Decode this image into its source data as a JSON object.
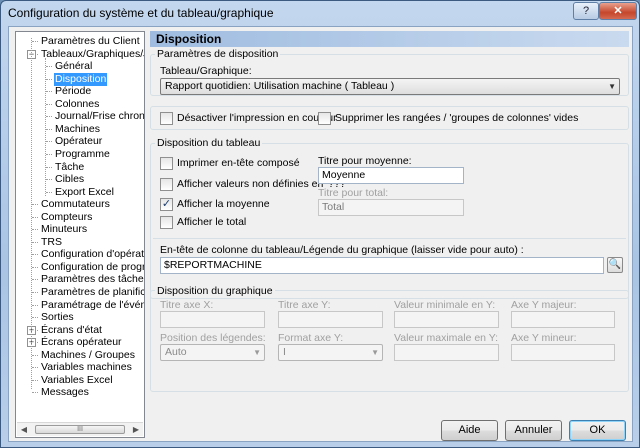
{
  "window": {
    "title": "Configuration du système et du tableau/graphique",
    "help_glyph": "?",
    "close_glyph": "✕"
  },
  "tree": {
    "items": [
      {
        "label": "Paramètres du Client"
      },
      {
        "label": "Tableaux/Graphiques/Journal",
        "expanded": true
      },
      {
        "label": "Général"
      },
      {
        "label": "Disposition",
        "selected": true
      },
      {
        "label": "Période"
      },
      {
        "label": "Colonnes"
      },
      {
        "label": "Journal/Frise chronologique"
      },
      {
        "label": "Machines"
      },
      {
        "label": "Opérateur"
      },
      {
        "label": "Programme"
      },
      {
        "label": "Tâche"
      },
      {
        "label": "Cibles"
      },
      {
        "label": "Export Excel"
      },
      {
        "label": "Commutateurs"
      },
      {
        "label": "Compteurs"
      },
      {
        "label": "Minuteurs"
      },
      {
        "label": "TRS"
      },
      {
        "label": "Configuration d'opérateur"
      },
      {
        "label": "Configuration de programme"
      },
      {
        "label": "Paramètres des tâches"
      },
      {
        "label": "Paramètres de planification"
      },
      {
        "label": "Paramétrage de l'événement"
      },
      {
        "label": "Sorties"
      },
      {
        "label": "Écrans d'état",
        "expandable": true
      },
      {
        "label": "Écrans opérateur",
        "expandable": true
      },
      {
        "label": "Machines / Groupes"
      },
      {
        "label": "Variables machines"
      },
      {
        "label": "Variables Excel"
      },
      {
        "label": "Messages"
      }
    ],
    "expander_minus": "−",
    "expander_plus": "+",
    "scroll_left": "◀",
    "scroll_right": "▶",
    "scroll_grip": "III"
  },
  "panel": {
    "header": "Disposition",
    "layout_params": {
      "title": "Paramètres de disposition",
      "table_graph_label": "Tableau/Graphique:",
      "table_graph_value": "Rapport quotidien: Utilisation machine  ( Tableau )"
    },
    "options": {
      "disable_color_print": "Désactiver l'impression en couleur",
      "remove_empty_rows": "Supprimer les rangées / 'groupes de colonnes' vides"
    },
    "table_layout": {
      "title": "Disposition du tableau",
      "print_composite_header": "Imprimer en-tête composé",
      "show_undefined_values": "Afficher valeurs non définies en '???'",
      "show_average": "Afficher la moyenne",
      "show_total": "Afficher le total",
      "average_title_label": "Titre pour moyenne:",
      "average_title_value": "Moyenne",
      "total_title_label": "Titre pour total:",
      "total_title_value": "Total"
    },
    "column_header": {
      "label": "En-tête de colonne du tableau/Légende du graphique (laisser vide pour auto) :",
      "value": "$REPORTMACHINE"
    },
    "graph_layout": {
      "title": "Disposition du graphique",
      "x_axis_title": "Titre axe X:",
      "y_axis_title": "Titre axe Y:",
      "y_min_label": "Valeur minimale en Y:",
      "y_major_label": "Axe Y majeur:",
      "legend_position_label": "Position des légendes:",
      "legend_position_value": "Auto",
      "y_format_label": "Format axe Y:",
      "y_format_value": "I",
      "y_max_label": "Valeur maximale en Y:",
      "y_minor_label": "Axe Y mineur:"
    }
  },
  "footer": {
    "help": "Aide",
    "cancel": "Annuler",
    "ok": "OK"
  },
  "glyphs": {
    "dropdown": "▼",
    "check": "✓",
    "browse": "🔍"
  }
}
